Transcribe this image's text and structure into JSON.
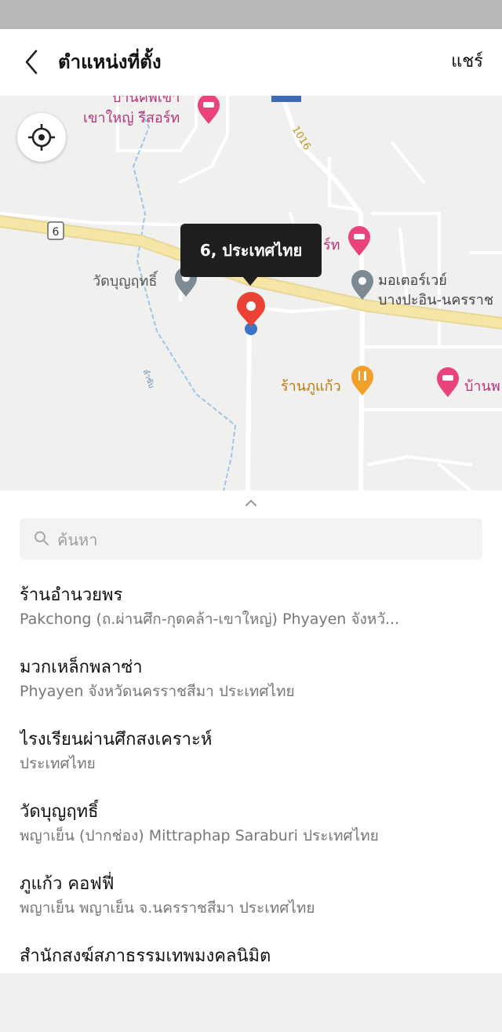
{
  "header": {
    "title": "ตำแหน่งที่ตั้ง",
    "share_label": "แชร์"
  },
  "map": {
    "pin_label": "6, ประเทศไทย",
    "road_shield": "6",
    "road_number": "1016",
    "labels": {
      "resort_line1": "บ้านคีพเขา",
      "resort_line2": "เขาใหญ่ รีสอร์ท",
      "resort_right": "ร์ท",
      "temple": "วัดบุญฤทธิ์",
      "motorway_line1": "มอเตอร์เวย์",
      "motorway_line2": "บางปะอิน-นครราช",
      "restaurant": "ร้านภูแก้ว",
      "house_right": "บ้านพ",
      "stream": "ลำซับ"
    },
    "colors": {
      "hotel_pin": "#e9437c",
      "poi_pin": "#7b8a93",
      "food_pin": "#f1a12a",
      "location_pin": "#ea4335",
      "main_road": "#f6e6a5"
    },
    "icons": [
      "crosshair-icon",
      "hotel-icon",
      "place-icon",
      "restaurant-icon",
      "location-pin-icon"
    ]
  },
  "search": {
    "placeholder": "ค้นหา",
    "value": ""
  },
  "results": [
    {
      "name": "ร้านอำนวยพร",
      "address": "Pakchong (ถ.ผ่านศึก-กุดคล้า-เขาใหญ่) Phyayen จังหวั..."
    },
    {
      "name": "มวกเหล็กพลาซ่า",
      "address": "Phyayen จังหวัดนครราชสีมา ประเทศไทย"
    },
    {
      "name": "ไรงเรียนผ่านศึกสงเคราะห์",
      "address": "ประเทศไทย"
    },
    {
      "name": "วัดบุญฤทธิ์",
      "address": "พญาเย็น (ปากช่อง) Mittraphap Saraburi ประเทศไทย"
    },
    {
      "name": "ภูแก้ว คอฟฟี่",
      "address": "พญาเย็น พญาเย็น จ.นครราชสีมา ประเทศไทย"
    },
    {
      "name": "สำนักสงฆ์สภาธรรมเทพมงคลนิมิต",
      "address": ""
    }
  ]
}
